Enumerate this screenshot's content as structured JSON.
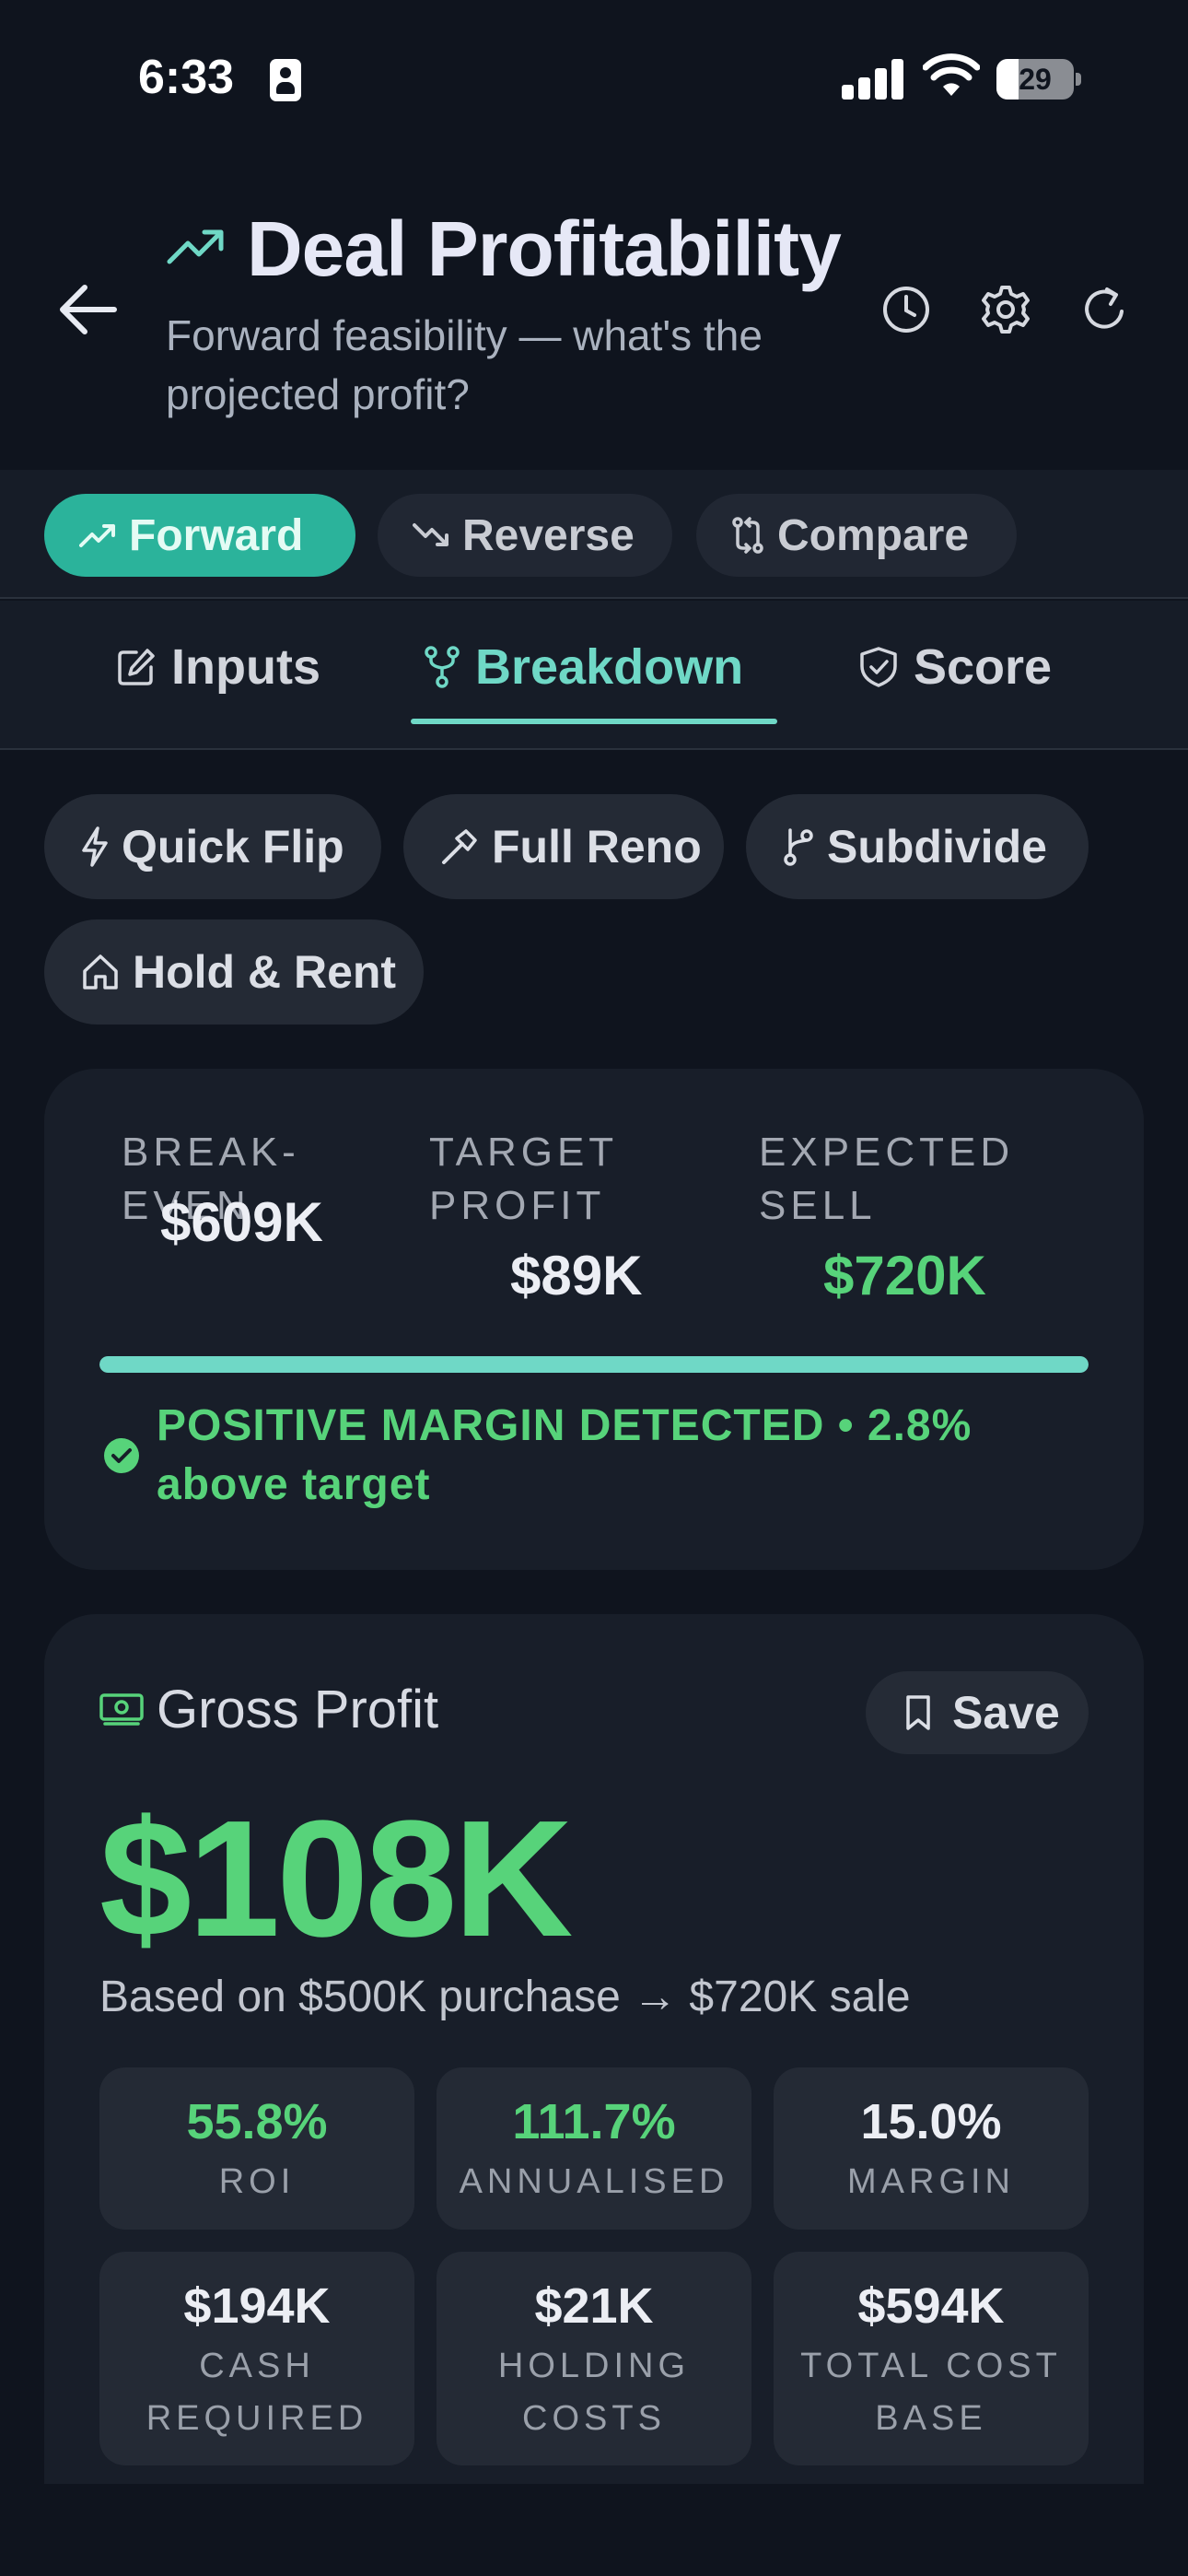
{
  "status_bar": {
    "time": "6:33",
    "battery": "29",
    "battery_level": 0.29
  },
  "header": {
    "title": "Deal Profitability",
    "subtitle": "Forward feasibility — what's the projected profit?",
    "icons": [
      "back-arrow-icon",
      "trending-up-icon",
      "history-icon",
      "gear-icon",
      "refresh-icon"
    ]
  },
  "modes": [
    {
      "label": "Forward",
      "icon": "trending-up-icon",
      "active": true
    },
    {
      "label": "Reverse",
      "icon": "trending-down-icon",
      "active": false
    },
    {
      "label": "Compare",
      "icon": "compare-arrows-icon",
      "active": false
    }
  ],
  "tabs": [
    {
      "label": "Inputs",
      "icon": "edit-icon",
      "active": false
    },
    {
      "label": "Breakdown",
      "icon": "fork-icon",
      "active": true
    },
    {
      "label": "Score",
      "icon": "shield-check-icon",
      "active": false
    }
  ],
  "strategies": [
    {
      "label": "Quick Flip",
      "icon": "lightning-icon"
    },
    {
      "label": "Full Reno",
      "icon": "hammer-icon"
    },
    {
      "label": "Subdivide",
      "icon": "branch-icon"
    },
    {
      "label": "Hold & Rent",
      "icon": "home-icon"
    }
  ],
  "metrics": {
    "break_even_label": "BREAK-EVEN",
    "break_even_value": "$609K",
    "target_profit_label": "TARGET PROFIT",
    "target_profit_value": "$89K",
    "expected_sell_label": "EXPECTED SELL",
    "expected_sell_value": "$720K",
    "progress": 1.0,
    "status_message": "POSITIVE MARGIN DETECTED  •  2.8% above target",
    "accent": "#6fd8c6",
    "positive": "#57d37a"
  },
  "gross_profit": {
    "title": "Gross Profit",
    "save_label": "Save",
    "value": "$108K",
    "basis": "Based on $500K purchase → $720K sale",
    "stats": [
      {
        "value": "55.8%",
        "label": "ROI",
        "green": true
      },
      {
        "value": "111.7%",
        "label": "ANNUALISED",
        "green": true
      },
      {
        "value": "15.0%",
        "label": "MARGIN",
        "green": false
      },
      {
        "value": "$194K",
        "label": "CASH REQUIRED",
        "green": false
      },
      {
        "value": "$21K",
        "label": "HOLDING COSTS",
        "green": false
      },
      {
        "value": "$594K",
        "label": "TOTAL COST BASE",
        "green": false
      }
    ]
  }
}
